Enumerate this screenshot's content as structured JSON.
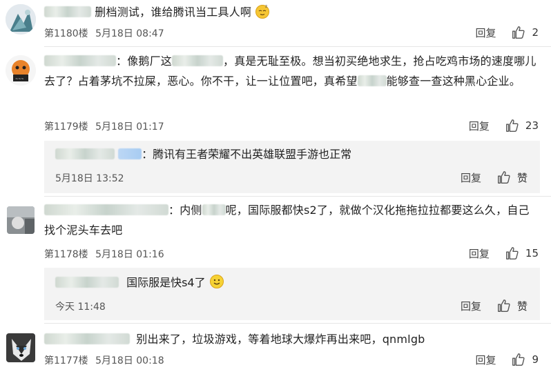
{
  "comments": [
    {
      "text_after": "删档测试，谁给腾讯当工具人啊",
      "emoji": "sleepy-emoji",
      "floor": "第1180楼",
      "date": "5月18日 08:47",
      "reply_label": "回复",
      "likes": "2"
    },
    {
      "text_a": "：像鹅厂这",
      "text_b": "，真是无耻至极。想当初买绝地求生，抢占吃鸡市场的速度哪儿去了？占着茅坑不拉屎，恶心。你不干，让一让位置吧，真希望",
      "text_c": "能够查一查这种黑心企业。",
      "floor": "第1179楼",
      "date": "5月18日 01:17",
      "reply_label": "回复",
      "likes": "23",
      "reply": {
        "text": "：腾讯有王者荣耀不出英雄联盟手游也正常",
        "date": "5月18日 13:52",
        "reply_label": "回复",
        "like_label": "赞"
      }
    },
    {
      "text_a": "：内侧",
      "text_b": "呢，国际服都快s2了，就做个汉化拖拖拉拉都要这么久，自己找个泥头车去吧",
      "floor": "第1178楼",
      "date": "5月18日 01:16",
      "reply_label": "回复",
      "likes": "15",
      "reply": {
        "text": "国际服是快s4了",
        "emoji": "smile-emoji",
        "date": "今天 11:48",
        "reply_label": "回复",
        "like_label": "赞"
      }
    },
    {
      "text": "别出来了，垃圾游戏，等着地球大爆炸再出来吧，qnmlgb",
      "floor": "第1177楼",
      "date": "5月18日 00:18",
      "reply_label": "回复",
      "likes": "9"
    }
  ],
  "colors": {
    "reply_bg": "#f3f3f3",
    "divider": "#e6e6e6",
    "meta": "#555555"
  }
}
